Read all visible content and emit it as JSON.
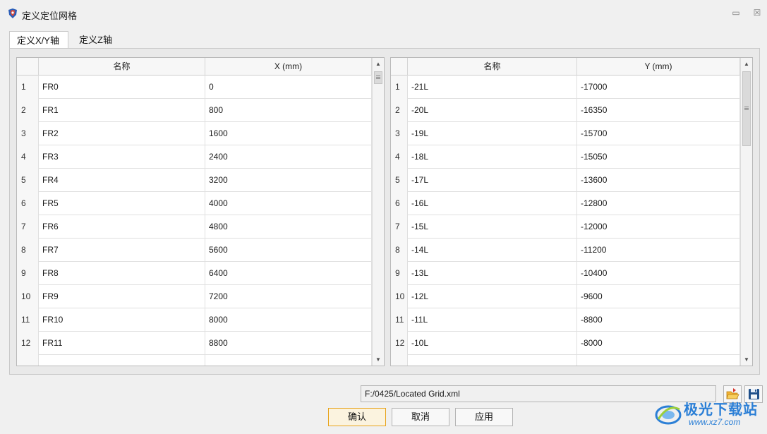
{
  "window": {
    "title": "定义定位网格",
    "pin_glyph": "▭",
    "close_glyph": "☒"
  },
  "tabs": [
    {
      "label": "定义X/Y轴",
      "active": true
    },
    {
      "label": "定义Z轴",
      "active": false
    }
  ],
  "x_table": {
    "headers": {
      "index": "",
      "name": "名称",
      "value": "X (mm)"
    },
    "rows": [
      {
        "index": "1",
        "name": "FR0",
        "value": "0"
      },
      {
        "index": "2",
        "name": "FR1",
        "value": "800"
      },
      {
        "index": "3",
        "name": "FR2",
        "value": "1600"
      },
      {
        "index": "4",
        "name": "FR3",
        "value": "2400"
      },
      {
        "index": "5",
        "name": "FR4",
        "value": "3200"
      },
      {
        "index": "6",
        "name": "FR5",
        "value": "4000"
      },
      {
        "index": "7",
        "name": "FR6",
        "value": "4800"
      },
      {
        "index": "8",
        "name": "FR7",
        "value": "5600"
      },
      {
        "index": "9",
        "name": "FR8",
        "value": "6400"
      },
      {
        "index": "10",
        "name": "FR9",
        "value": "7200"
      },
      {
        "index": "11",
        "name": "FR10",
        "value": "8000"
      },
      {
        "index": "12",
        "name": "FR11",
        "value": "8800"
      },
      {
        "index": "",
        "name": "",
        "value": ""
      }
    ]
  },
  "y_table": {
    "headers": {
      "index": "",
      "name": "名称",
      "value": "Y (mm)"
    },
    "rows": [
      {
        "index": "1",
        "name": "-21L",
        "value": "-17000"
      },
      {
        "index": "2",
        "name": "-20L",
        "value": "-16350"
      },
      {
        "index": "3",
        "name": "-19L",
        "value": "-15700"
      },
      {
        "index": "4",
        "name": "-18L",
        "value": "-15050"
      },
      {
        "index": "5",
        "name": "-17L",
        "value": "-13600"
      },
      {
        "index": "6",
        "name": "-16L",
        "value": "-12800"
      },
      {
        "index": "7",
        "name": "-15L",
        "value": "-12000"
      },
      {
        "index": "8",
        "name": "-14L",
        "value": "-11200"
      },
      {
        "index": "9",
        "name": "-13L",
        "value": "-10400"
      },
      {
        "index": "10",
        "name": "-12L",
        "value": "-9600"
      },
      {
        "index": "11",
        "name": "-11L",
        "value": "-8800"
      },
      {
        "index": "12",
        "name": "-10L",
        "value": "-8000"
      },
      {
        "index": "",
        "name": "",
        "value": ""
      }
    ]
  },
  "scrollbar": {
    "up_glyph": "▲",
    "down_glyph": "▼"
  },
  "file": {
    "path": "F:/0425/Located Grid.xml",
    "open_icon": "folder-open-icon",
    "save_icon": "floppy-disk-icon"
  },
  "buttons": {
    "ok": "确认",
    "cancel": "取消",
    "apply": "应用"
  },
  "watermark": {
    "title": "极光下载站",
    "url": "www.xz7.com"
  },
  "colors": {
    "accent": "#e7a31b",
    "watermark": "#2b7fd6"
  }
}
